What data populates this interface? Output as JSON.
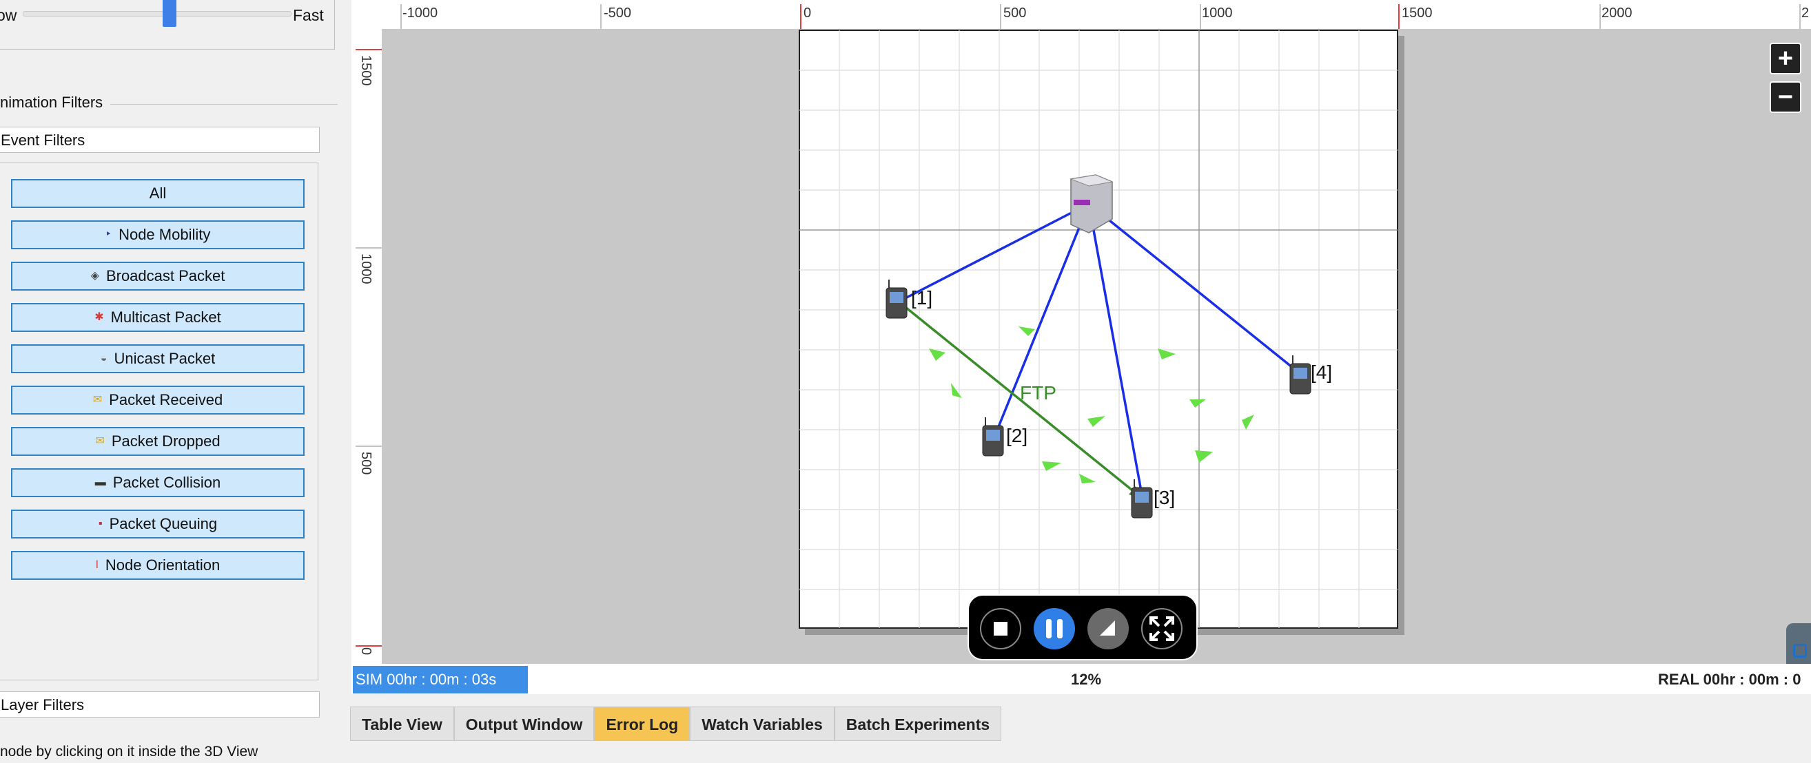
{
  "speed": {
    "slow_label": "ow",
    "fast_label": "Fast",
    "value_fraction": 0.55
  },
  "animation_filters": {
    "title": "nimation Filters",
    "event_filters_label": "Event Filters",
    "buttons": [
      {
        "label": "All",
        "icon": ""
      },
      {
        "label": "Node Mobility",
        "icon": "node-mobility-icon"
      },
      {
        "label": "Broadcast Packet",
        "icon": "broadcast-packet-icon"
      },
      {
        "label": "Multicast Packet",
        "icon": "multicast-packet-icon"
      },
      {
        "label": "Unicast Packet",
        "icon": "unicast-packet-icon"
      },
      {
        "label": "Packet Received",
        "icon": "packet-received-icon"
      },
      {
        "label": "Packet Dropped",
        "icon": "packet-dropped-icon"
      },
      {
        "label": "Packet Collision",
        "icon": "packet-collision-icon"
      },
      {
        "label": "Packet Queuing",
        "icon": "packet-queuing-icon"
      },
      {
        "label": "Node Orientation",
        "icon": "node-orientation-icon"
      }
    ],
    "layer_filters_label": "Layer Filters"
  },
  "hint": "node by clicking on it inside the 3D View",
  "ruler_top": [
    "-1000",
    "-500",
    "0",
    "500",
    "1000",
    "1500",
    "2000",
    "2"
  ],
  "ruler_left": [
    "1500",
    "1000",
    "500",
    "0"
  ],
  "scene": {
    "nodes": [
      {
        "label": "[1]"
      },
      {
        "label": "[2]"
      },
      {
        "label": "[3]"
      },
      {
        "label": "[4]"
      }
    ],
    "link_label": "FTP",
    "colors": {
      "wireless_link": "#1a2ee6",
      "ftp_link": "#3a8c2a",
      "packet": "#66e044",
      "grid_bg": "#ffffff",
      "outside": "#c8c8c8"
    }
  },
  "zoom": {
    "in": "+",
    "out": "−"
  },
  "player": {
    "buttons": [
      "stop-icon",
      "pause-icon",
      "step-icon",
      "fullscreen-icon"
    ]
  },
  "status": {
    "sim_time": "SIM 00hr : 00m : 03s",
    "progress": "12%",
    "real_time": "REAL 00hr : 00m : 0"
  },
  "tabs": [
    {
      "label": "Table View",
      "active": false
    },
    {
      "label": "Output Window",
      "active": false
    },
    {
      "label": "Error Log",
      "active": true
    },
    {
      "label": "Watch Variables",
      "active": false
    },
    {
      "label": "Batch Experiments",
      "active": false
    }
  ]
}
